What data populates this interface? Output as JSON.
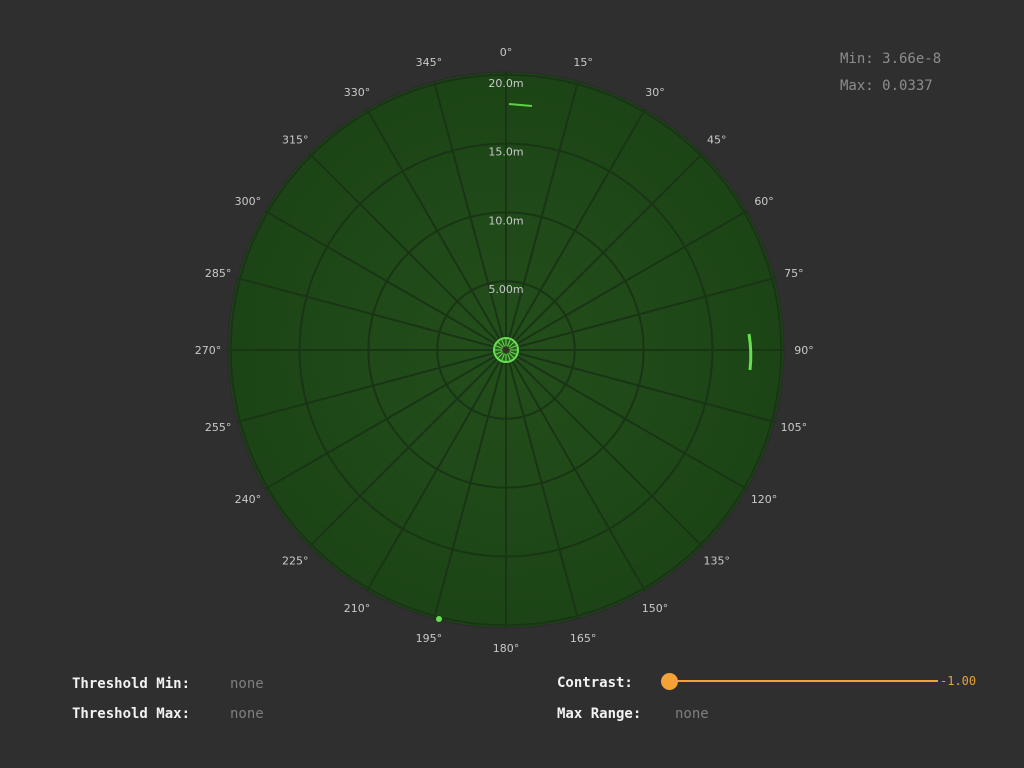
{
  "stats": {
    "min": "Min: 3.66e-8",
    "max": "Max: 0.0337"
  },
  "sonar": {
    "angle_labels": [
      "0°",
      "15°",
      "30°",
      "45°",
      "60°",
      "75°",
      "90°",
      "105°",
      "120°",
      "135°",
      "150°",
      "165°",
      "180°",
      "195°",
      "210°",
      "225°",
      "240°",
      "255°",
      "270°",
      "285°",
      "300°",
      "315°",
      "330°",
      "345°"
    ],
    "range_labels": [
      "5.00m",
      "10.0m",
      "15.0m",
      "20.0m"
    ],
    "colors": {
      "disk": "#1e4a17",
      "grid": "#1a3416",
      "echo": "#66e04e"
    }
  },
  "controls": {
    "threshold_min_label": "Threshold Min:",
    "threshold_min_value": "none",
    "threshold_max_label": "Threshold Max:",
    "threshold_max_value": "none",
    "contrast_label": "Contrast:",
    "contrast_value": "-1.00",
    "contrast_level": 0,
    "max_range_label": "Max Range:",
    "max_range_value": "none",
    "accent_color": "#f4a236"
  }
}
